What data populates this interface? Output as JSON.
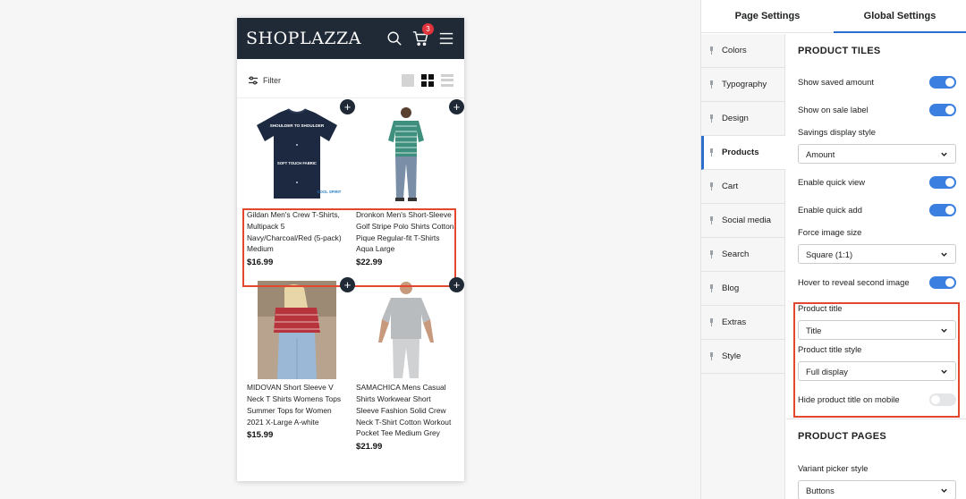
{
  "preview": {
    "logo": "SHOPLAZZA",
    "cart_count": "3",
    "filter_label": "Filter",
    "products": [
      {
        "title": "Gildan Men's Crew T-Shirts, Multipack 5 Navy/Charcoal/Red (5-pack) Medium",
        "price": "$16.99",
        "shirt_text_1": "SHOULDER TO SHOULDER",
        "shirt_text_2": "SOFT TOUCH FABRIC",
        "brand_mark": "COOL SPIRIT"
      },
      {
        "title": "Dronkon Men's Short-Sleeve Golf Stripe Polo Shirts Cotton Pique Regular-fit T-Shirts Aqua Large",
        "price": "$22.99"
      },
      {
        "title": "MIDOVAN Short Sleeve V Neck T Shirts Womens Tops Summer Tops for Women 2021 X-Large A-white",
        "price": "$15.99"
      },
      {
        "title": "SAMACHICA Mens Casual Shirts Workwear Short Sleeve Fashion Solid Crew Neck T-Shirt Cotton Workout Pocket Tee Medium Grey",
        "price": "$21.99"
      }
    ],
    "add_symbol": "+"
  },
  "settings": {
    "tabs": [
      "Page Settings",
      "Global Settings"
    ],
    "nav": [
      "Colors",
      "Typography",
      "Design",
      "Products",
      "Cart",
      "Social media",
      "Search",
      "Blog",
      "Extras",
      "Style"
    ],
    "active_nav": "Products",
    "product_tiles": {
      "title": "PRODUCT TILES",
      "show_saved_amount": "Show saved amount",
      "show_on_sale_label": "Show on sale label",
      "savings_display_style": "Savings display style",
      "savings_display_value": "Amount",
      "enable_quick_view": "Enable quick view",
      "enable_quick_add": "Enable quick add",
      "force_image_size": "Force image size",
      "force_image_size_value": "Square (1:1)",
      "hover_reveal": "Hover to reveal second image",
      "product_title": "Product title",
      "product_title_value": "Title",
      "product_title_style": "Product title style",
      "product_title_style_value": "Full display",
      "hide_title_mobile": "Hide product title on mobile"
    },
    "product_pages": {
      "title": "PRODUCT PAGES",
      "variant_picker_style": "Variant picker style",
      "variant_picker_value": "Buttons"
    }
  },
  "colors": {
    "accent": "#2c6ecb",
    "toggle_on": "#3b7fe0",
    "header_bg": "#1f2a36",
    "highlight": "#e3472f",
    "badge": "#e0333b"
  }
}
